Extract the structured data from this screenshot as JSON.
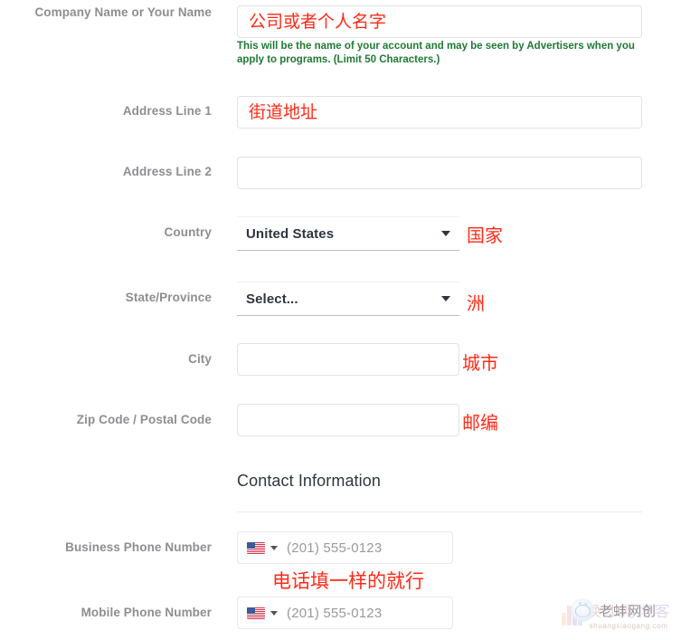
{
  "form": {
    "fields": [
      {
        "label": "Company Name or Your Name",
        "type": "text",
        "value": "公司或者个人名字",
        "helper": "This will be the name of your account and may be seen by Advertisers when you apply to programs. (Limit 50 Characters.)"
      },
      {
        "label": "Address Line 1",
        "type": "text",
        "value": "街道地址"
      },
      {
        "label": "Address Line 2",
        "type": "text",
        "value": ""
      },
      {
        "label": "Country",
        "type": "select",
        "value": "United States",
        "annotation": "国家"
      },
      {
        "label": "State/Province",
        "type": "select",
        "value": "Select...",
        "annotation": "洲"
      },
      {
        "label": "City",
        "type": "text",
        "value": "",
        "annotation": "城市"
      },
      {
        "label": "Zip Code / Postal Code",
        "type": "text",
        "value": "",
        "annotation": "邮编"
      }
    ],
    "section": {
      "title": "Contact Information"
    },
    "phone_fields": [
      {
        "label": "Business Phone Number",
        "placeholder": "(201) 555-0123",
        "flag": "us-flag-icon"
      },
      {
        "label": "Mobile Phone Number",
        "placeholder": "(201) 555-0123",
        "flag": "us-flag-icon"
      }
    ],
    "phone_annotation": "电话填一样的就行"
  },
  "watermarks": {
    "primary": "老蚌网创",
    "secondary": "焕才网博客",
    "url": "shuangxiaogang.com"
  },
  "colors": {
    "annotation_red": "#ff2a17",
    "helper_green": "#1f7a34",
    "label_gray": "#8e8e93"
  }
}
